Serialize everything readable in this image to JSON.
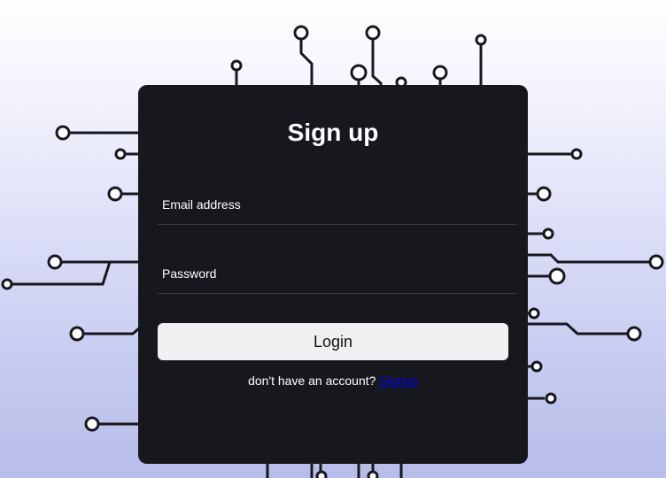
{
  "form": {
    "title": "Sign up",
    "email_label": "Email address",
    "password_label": "Password",
    "login_label": "Login",
    "prompt_text": "don't have an account?",
    "signup_link": "Signup"
  },
  "colors": {
    "card_bg": "#17181e",
    "button_bg": "#f0f0f0",
    "link": "#0000ee",
    "circuit": "#17181e"
  }
}
